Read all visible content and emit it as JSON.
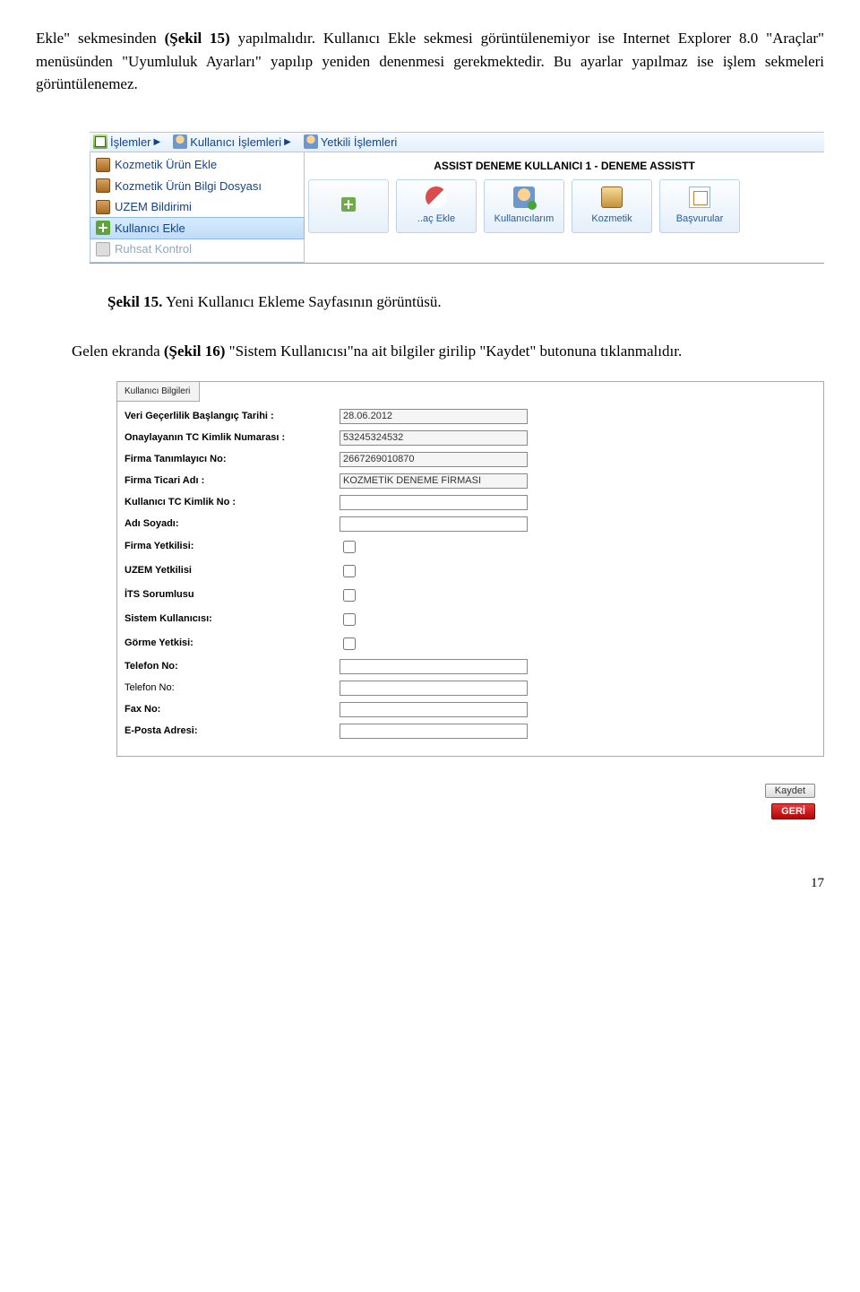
{
  "para1_a": "Ekle\" sekmesinden ",
  "para1_b": "(Şekil 15)",
  "para1_c": " yapılmalıdır. Kullanıcı Ekle sekmesi görüntülenemiyor ise Internet Explorer 8.0 \"Araçlar\" menüsünden \"Uyumluluk Ayarları\" yapılıp yeniden denenmesi gerekmektedir. Bu ayarlar yapılmaz ise işlem sekmeleri görüntülenemez.",
  "menu": {
    "top": {
      "islemler": "İşlemler",
      "kullanici": "Kullanıcı İşlemleri",
      "yetkili": "Yetkili İşlemleri"
    },
    "dropdown": {
      "i0": "Kozmetik Ürün Ekle",
      "i1": "Kozmetik Ürün Bilgi Dosyası",
      "i2": "UZEM Bildirimi",
      "i3": "Kullanıcı Ekle",
      "i4": "Ruhsat Kontrol"
    },
    "user_banner": "ASSIST DENEME KULLANICI 1 - DENEME ASSISTT",
    "toolbar": {
      "b0": " ",
      "b1": "..aç Ekle",
      "b2": "Kullanıcılarım",
      "b3": "Kozmetik",
      "b4": "Başvurular"
    }
  },
  "caption1_bold": "Şekil 15.",
  "caption1_rest": " Yeni Kullanıcı Ekleme Sayfasının görüntüsü.",
  "para2_a": "Gelen ekranda ",
  "para2_b": "(Şekil 16)",
  "para2_c": " \"Sistem Kullanıcısı\"na ait bilgiler girilip \"Kaydet\" butonuna tıklanmalıdır.",
  "form": {
    "tab": "Kullanıcı Bilgileri",
    "labels": {
      "l0": "Veri Geçerlilik Başlangıç Tarihi :",
      "l1": "Onaylayanın TC Kimlik Numarası :",
      "l2": "Firma Tanımlayıcı No:",
      "l3": "Firma Ticari Adı :",
      "l4": "Kullanıcı TC Kimlik No :",
      "l5": "Adı Soyadı:",
      "l6": "Firma Yetkilisi:",
      "l7": "UZEM Yetkilisi",
      "l8": "İTS Sorumlusu",
      "l9": "Sistem Kullanıcısı:",
      "l10": "Görme Yetkisi:",
      "l11": "Telefon No:",
      "l12": "Telefon No:",
      "l13": "Fax No:",
      "l14": "E-Posta Adresi:"
    },
    "values": {
      "v0": "28.06.2012",
      "v1": "53245324532",
      "v2": "2667269010870",
      "v3": "KOZMETİK DENEME FİRMASI"
    }
  },
  "buttons": {
    "kaydet": "Kaydet",
    "geri": "GERİ"
  },
  "page_number": "17"
}
